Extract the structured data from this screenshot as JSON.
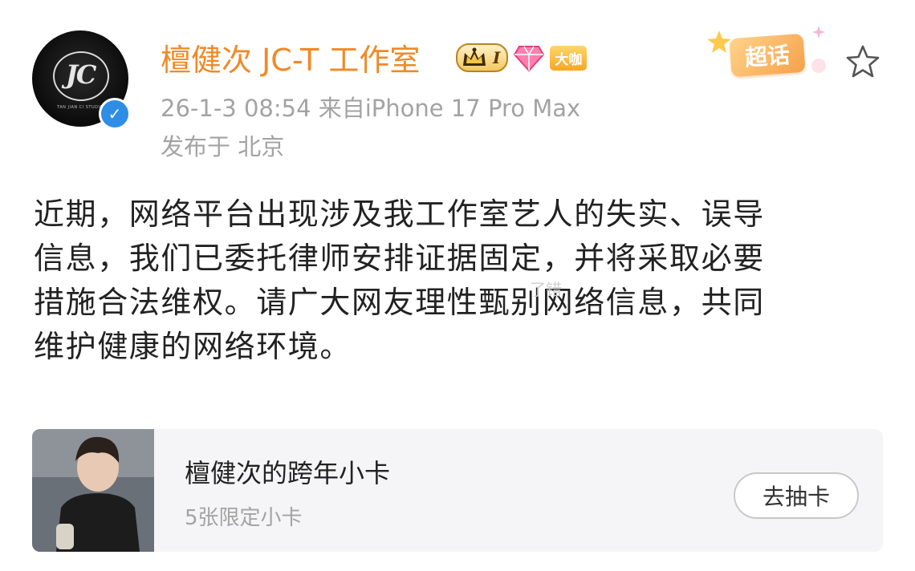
{
  "post": {
    "author": "檀健次 JC-T 工作室",
    "meta_line": "26-1-3 08:54  来自iPhone 17 Pro Max",
    "location_line": "发布于 北京",
    "badges": {
      "level": "I",
      "big_shot": "大咖",
      "topic_label": "超话"
    },
    "avatar_logo": "JC",
    "avatar_caption": "TAN JIAN CI STUDIO",
    "verified_mark": "✓",
    "body_lines": [
      "近期，网络平台出现涉及我工作室艺人的失实、误导",
      "信息，我们已委托律师安排证据固定，并将采取必要",
      "措施合法维权。请广大网友理性甄别网络信息，共同",
      "维护健康的网络环境。"
    ],
    "watermark": "了错"
  },
  "card": {
    "title": "檀健次的跨年小卡",
    "subtitle": "5张限定小卡",
    "button_label": "去抽卡"
  },
  "colors": {
    "username": "#f08a26",
    "meta_gray": "#a3a3a3",
    "body_text": "#222222",
    "verified_blue": "#2e8ee6",
    "card_bg": "#f5f5f7"
  },
  "icons": [
    "verified-icon",
    "crown-icon",
    "gem-icon",
    "star-icon"
  ]
}
